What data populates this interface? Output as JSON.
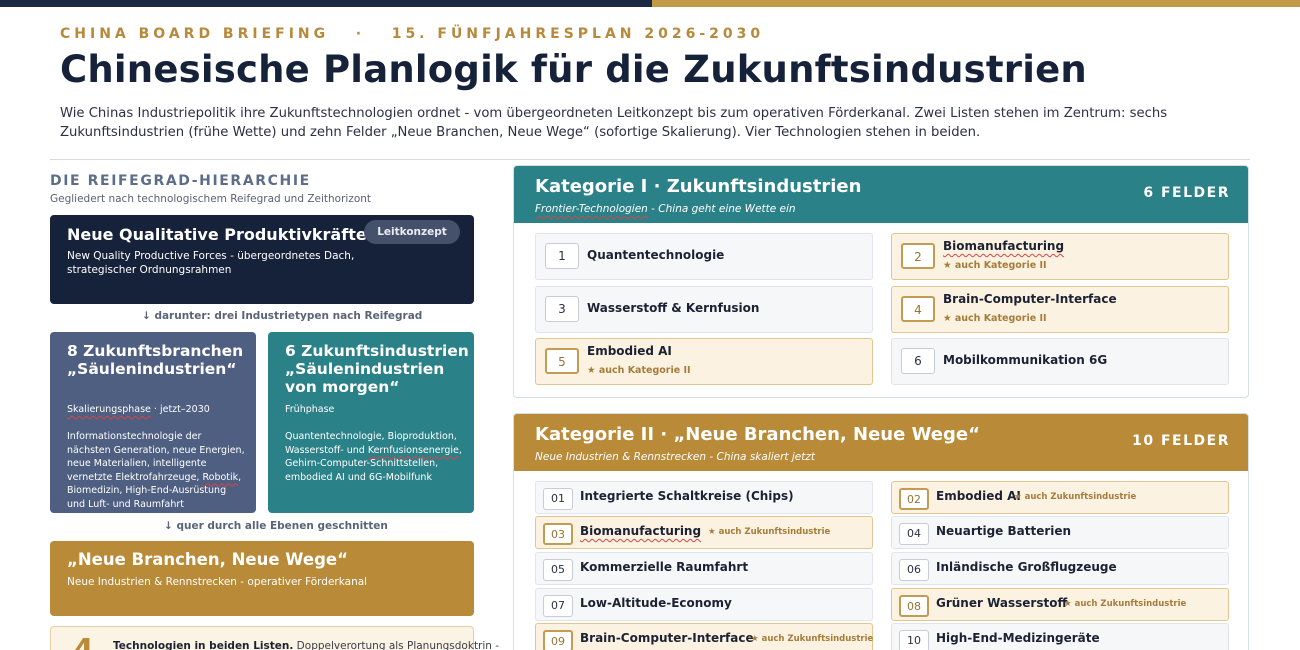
{
  "header": {
    "kicker": "CHINA BOARD BRIEFING   ·   15. FÜNFJAHRESPLAN 2026-2030",
    "title": "Chinesische Planlogik für die Zukunftsindustrien",
    "intro": "Wie Chinas Industriepolitik ihre Zukunftstechnologien ordnet - vom übergeordneten Leitkonzept bis zum operativen Förderkanal. Zwei Listen stehen im Zentrum: sechs Zukunftsindustrien (frühe Wette) und zehn Felder „Neue Branchen, Neue Wege“ (sofortige Skalierung). Vier Technologien stehen in beiden."
  },
  "hierarchy": {
    "heading": "DIE REIFEGRAD-HIERARCHIE",
    "subheading": "Gegliedert nach technologischem Reifegrad und Zeithorizont",
    "concept": {
      "title": "Neue Qualitative Produktivkräfte",
      "badge": "Leitkonzept",
      "subtitle": "New Quality Productive Forces - übergeordnetes Dach, strategischer Ordnungsrahmen"
    },
    "arrow1": "↓  darunter: drei Industrietypen nach Reifegrad",
    "pillar": {
      "title": "8 Zukunftsbranchen „Säulenindustrien“",
      "phase": "Skalierungsphase · jetzt–2030",
      "phase_marked": "Skalierungsphase",
      "phase_rest": " · jetzt–2030",
      "desc_a": "Informationstechnologie der nächsten Generation, neue Energien, neue Materialien, intelligente vernetzte Elektrofahrzeuge, ",
      "desc_marked": "Robotik",
      "desc_b": ", Biomedizin, High-End-Ausrüstung und Luft- und Raumfahrt"
    },
    "future": {
      "title": "6 Zukunftsindustrien „Säulenindustrien von morgen“",
      "phase": "Frühphase",
      "desc_a": "Quantentechnologie, Bioproduktion, Wasserstoff- und ",
      "desc_marked": "Kernfusionsenergie",
      "desc_b": ", Gehirn-Computer-Schnittstellen, embodied AI und 6G-Mobilfunk"
    },
    "arrow2": "↓  quer durch alle Ebenen geschnitten",
    "newbranches": {
      "title": "„Neue Branchen, Neue Wege“",
      "subtitle": "Neue Industrien & Rennstrecken - operativer Förderkanal"
    },
    "both": {
      "number": "4",
      "label": "Technologien in beiden Listen.",
      "text": " Doppelverortung als Planungsdoktrin -"
    }
  },
  "category1": {
    "title": "Kategorie I · Zukunftsindustrien",
    "subtitle_marked": "Frontier-Technologien",
    "subtitle_rest": " - China geht eine Wette ein",
    "count": "6 FELDER",
    "items": [
      {
        "num": "1",
        "name": "Quantentechnologie",
        "also": ""
      },
      {
        "num": "2",
        "name": "Biomanufacturing",
        "also": "★ auch Kategorie II"
      },
      {
        "num": "3",
        "name": "Wasserstoff & Kernfusion",
        "also": ""
      },
      {
        "num": "4",
        "name": "Brain-Computer-Interface",
        "also": "★ auch Kategorie II"
      },
      {
        "num": "5",
        "name": "Embodied AI",
        "also": "★ auch Kategorie II"
      },
      {
        "num": "6",
        "name": "Mobilkommunikation 6G",
        "also": ""
      }
    ]
  },
  "category2": {
    "title": "Kategorie II · „Neue Branchen, Neue Wege“",
    "subtitle": "Neue Industrien & Rennstrecken - China skaliert jetzt",
    "count": "10 FELDER",
    "items": [
      {
        "num": "01",
        "name": "Integrierte Schaltkreise (Chips)",
        "also": ""
      },
      {
        "num": "02",
        "name": "Embodied AI",
        "also": "★ auch Zukunftsindustrie"
      },
      {
        "num": "03",
        "name": "Biomanufacturing",
        "also": "★ auch Zukunftsindustrie"
      },
      {
        "num": "04",
        "name": "Neuartige Batterien",
        "also": ""
      },
      {
        "num": "05",
        "name": "Kommerzielle Raumfahrt",
        "also": ""
      },
      {
        "num": "06",
        "name": "Inländische Großflugzeuge",
        "also": ""
      },
      {
        "num": "07",
        "name": "Low-Altitude-Economy",
        "also": ""
      },
      {
        "num": "08",
        "name": "Grüner Wasserstoff",
        "also": "★ auch Zukunftsindustrie"
      },
      {
        "num": "09",
        "name": "Brain-Computer-Interface",
        "also": "★ auch Zukunftsindustrie"
      },
      {
        "num": "10",
        "name": "High-End-Medizingeräte",
        "also": ""
      }
    ]
  },
  "colors": {
    "navy": "#16213a",
    "slate": "#4f5f82",
    "teal": "#2b8188",
    "gold": "#b98a37",
    "highlight_bg": "#fcf2e1"
  }
}
